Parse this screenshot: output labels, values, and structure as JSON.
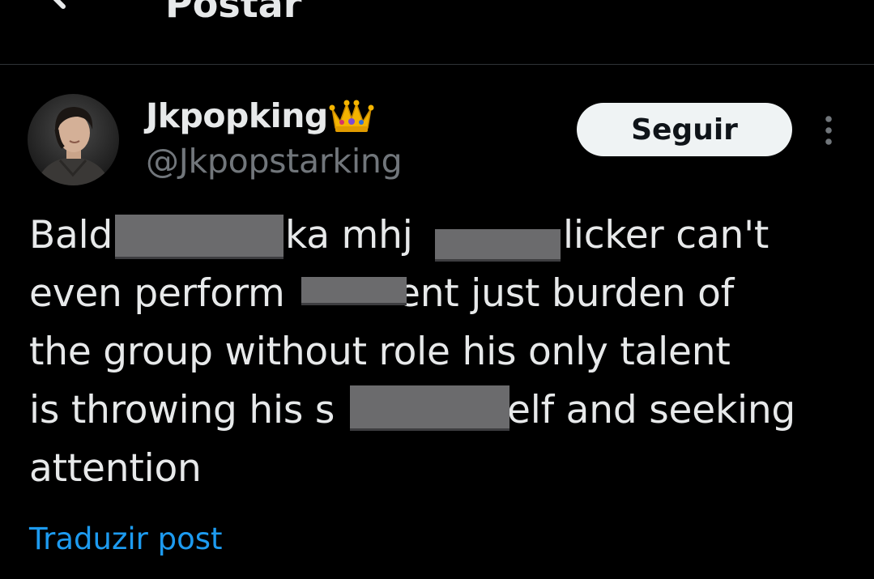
{
  "header": {
    "title": "Postar",
    "back_icon": "arrow-left-icon"
  },
  "author": {
    "display_name": "Jkpopking",
    "handle": "@Jkpopstarking",
    "badge_icon": "crown-icon",
    "avatar_icon": "avatar-photo"
  },
  "follow_button": {
    "label": "Seguir"
  },
  "more_icon": "more-vertical-icon",
  "post": {
    "lines": [
      {
        "before": "Bald",
        "middle": "ka mhj",
        "after": "licker can't"
      },
      {
        "before": "even perform",
        "after": "ent just burden of"
      },
      {
        "text": "the group without role his only talent"
      },
      {
        "before": "is throwing his s",
        "after": "elf and seeking"
      },
      {
        "text": "attention"
      }
    ]
  },
  "translate_link": "Traduzir post",
  "colors": {
    "background": "#000000",
    "text_primary": "#e7e9ea",
    "text_secondary": "#71767b",
    "link": "#1d9bf0",
    "divider": "#2f3336",
    "redaction": "#6b6b6d"
  }
}
